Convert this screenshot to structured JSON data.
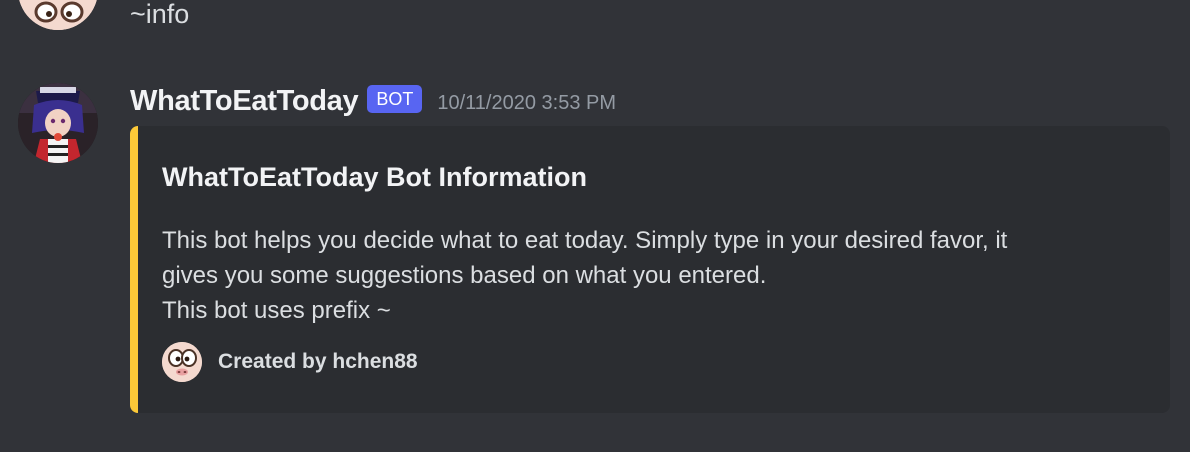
{
  "previous_message": {
    "content": "~info"
  },
  "message": {
    "username": "WhatToEatToday",
    "badge": "BOT",
    "timestamp": "10/11/2020 3:53 PM",
    "embed": {
      "accent_color": "#fcc938",
      "title": "WhatToEatToday Bot Information",
      "description_lines": [
        "This bot helps you decide what to eat today. Simply type in your desired favor, it",
        "gives you some suggestions based on what you entered.",
        "This bot uses prefix ~"
      ],
      "footer": {
        "icon": "cartoon-face-icon",
        "text": "Created by hchen88"
      }
    }
  },
  "colors": {
    "background": "#313338",
    "embed_background": "#2b2d31",
    "bot_badge": "#5865f2"
  }
}
